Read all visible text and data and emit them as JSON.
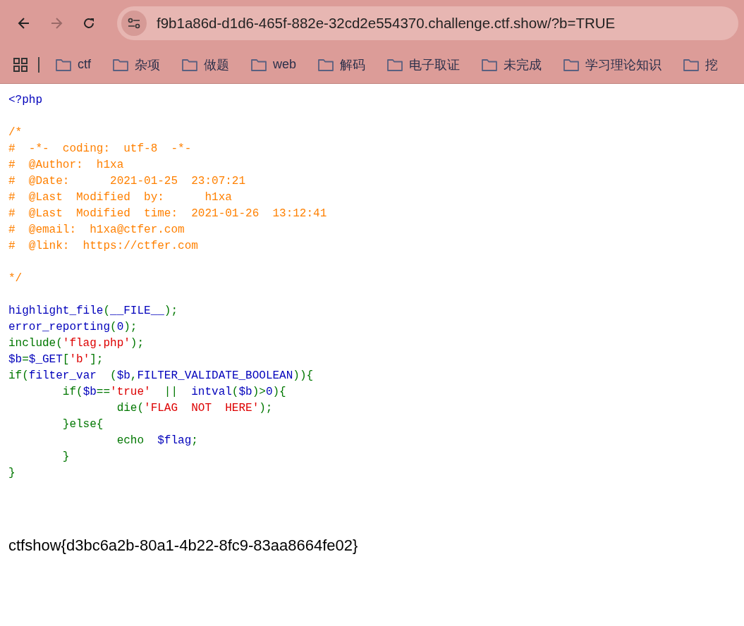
{
  "toolbar": {
    "nav": [
      {
        "kind": "back",
        "disabled": false
      },
      {
        "kind": "forward",
        "disabled": true
      },
      {
        "kind": "reload",
        "disabled": false
      }
    ],
    "address": "f9b1a86d-d1d6-465f-882e-32cd2e554370.challenge.ctf.show/?b=TRUE"
  },
  "bookmarks": [
    {
      "label": "ctf"
    },
    {
      "label": "杂项"
    },
    {
      "label": "做题"
    },
    {
      "label": "web"
    },
    {
      "label": "解码"
    },
    {
      "label": "电子取证"
    },
    {
      "label": "未完成"
    },
    {
      "label": "学习理论知识"
    },
    {
      "label": "挖"
    }
  ],
  "code_lines": [
    {
      "kind": "code",
      "tokens": [
        {
          "kind": "default",
          "text": "<?php"
        }
      ]
    },
    {
      "kind": "blank"
    },
    {
      "kind": "code",
      "tokens": [
        {
          "kind": "comment",
          "text": "/*"
        }
      ]
    },
    {
      "kind": "code",
      "tokens": [
        {
          "kind": "comment",
          "text": "#  -*-  coding:  utf-8  -*-"
        }
      ]
    },
    {
      "kind": "code",
      "tokens": [
        {
          "kind": "comment",
          "text": "#  @Author:  h1xa"
        }
      ]
    },
    {
      "kind": "code",
      "tokens": [
        {
          "kind": "comment",
          "text": "#  @Date:      2021-01-25  23:07:21"
        }
      ]
    },
    {
      "kind": "code",
      "tokens": [
        {
          "kind": "comment",
          "text": "#  @Last  Modified  by:      h1xa"
        }
      ]
    },
    {
      "kind": "code",
      "tokens": [
        {
          "kind": "comment",
          "text": "#  @Last  Modified  time:  2021-01-26  13:12:41"
        }
      ]
    },
    {
      "kind": "code",
      "tokens": [
        {
          "kind": "comment",
          "text": "#  @email:  h1xa@ctfer.com"
        }
      ]
    },
    {
      "kind": "code",
      "tokens": [
        {
          "kind": "comment",
          "text": "#  @link:  https://ctfer.com"
        }
      ]
    },
    {
      "kind": "blank"
    },
    {
      "kind": "code",
      "tokens": [
        {
          "kind": "comment",
          "text": "*/"
        }
      ]
    },
    {
      "kind": "blank"
    },
    {
      "kind": "code",
      "tokens": [
        {
          "kind": "default",
          "text": "highlight_file"
        },
        {
          "kind": "keyword",
          "text": "("
        },
        {
          "kind": "default",
          "text": "__FILE__"
        },
        {
          "kind": "keyword",
          "text": ");"
        }
      ]
    },
    {
      "kind": "code",
      "tokens": [
        {
          "kind": "default",
          "text": "error_reporting"
        },
        {
          "kind": "keyword",
          "text": "("
        },
        {
          "kind": "default",
          "text": "0"
        },
        {
          "kind": "keyword",
          "text": ");"
        }
      ]
    },
    {
      "kind": "code",
      "tokens": [
        {
          "kind": "keyword",
          "text": "include("
        },
        {
          "kind": "string",
          "text": "'flag.php'"
        },
        {
          "kind": "keyword",
          "text": ");"
        }
      ]
    },
    {
      "kind": "code",
      "tokens": [
        {
          "kind": "default",
          "text": "$b"
        },
        {
          "kind": "keyword",
          "text": "="
        },
        {
          "kind": "default",
          "text": "$_GET"
        },
        {
          "kind": "keyword",
          "text": "["
        },
        {
          "kind": "string",
          "text": "'b'"
        },
        {
          "kind": "keyword",
          "text": "];"
        }
      ]
    },
    {
      "kind": "code",
      "tokens": [
        {
          "kind": "keyword",
          "text": "if("
        },
        {
          "kind": "default",
          "text": "filter_var"
        },
        {
          "kind": "keyword",
          "text": "  ("
        },
        {
          "kind": "default",
          "text": "$b"
        },
        {
          "kind": "keyword",
          "text": ","
        },
        {
          "kind": "default",
          "text": "FILTER_VALIDATE_BOOLEAN"
        },
        {
          "kind": "keyword",
          "text": ")){"
        }
      ]
    },
    {
      "kind": "code",
      "tokens": [
        {
          "kind": "keyword",
          "text": "        if("
        },
        {
          "kind": "default",
          "text": "$b"
        },
        {
          "kind": "keyword",
          "text": "=="
        },
        {
          "kind": "string",
          "text": "'true'"
        },
        {
          "kind": "keyword",
          "text": "  ||  "
        },
        {
          "kind": "default",
          "text": "intval"
        },
        {
          "kind": "keyword",
          "text": "("
        },
        {
          "kind": "default",
          "text": "$b"
        },
        {
          "kind": "keyword",
          "text": ")>"
        },
        {
          "kind": "default",
          "text": "0"
        },
        {
          "kind": "keyword",
          "text": "){"
        }
      ]
    },
    {
      "kind": "code",
      "tokens": [
        {
          "kind": "keyword",
          "text": "                die("
        },
        {
          "kind": "string",
          "text": "'FLAG  NOT  HERE'"
        },
        {
          "kind": "keyword",
          "text": ");"
        }
      ]
    },
    {
      "kind": "code",
      "tokens": [
        {
          "kind": "keyword",
          "text": "        }else{"
        }
      ]
    },
    {
      "kind": "code",
      "tokens": [
        {
          "kind": "keyword",
          "text": "                echo  "
        },
        {
          "kind": "default",
          "text": "$flag"
        },
        {
          "kind": "keyword",
          "text": ";"
        }
      ]
    },
    {
      "kind": "code",
      "tokens": [
        {
          "kind": "keyword",
          "text": "        }"
        }
      ]
    },
    {
      "kind": "code",
      "tokens": [
        {
          "kind": "keyword",
          "text": "}"
        }
      ]
    }
  ],
  "output": "ctfshow{d3bc6a2b-80a1-4b22-8fc9-83aa8664fe02}"
}
